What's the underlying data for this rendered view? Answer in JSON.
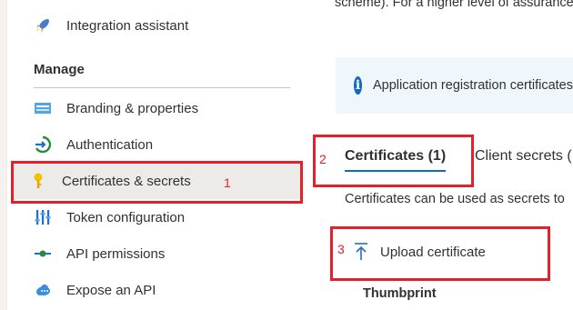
{
  "sidebar": {
    "top_item": {
      "label": "Integration assistant",
      "icon": "rocket-icon"
    },
    "section_label": "Manage",
    "items": [
      {
        "label": "Branding & properties",
        "icon": "branding-icon"
      },
      {
        "label": "Authentication",
        "icon": "authentication-icon"
      },
      {
        "label": "Certificates & secrets",
        "icon": "key-icon",
        "selected": true
      },
      {
        "label": "Token configuration",
        "icon": "token-config-icon"
      },
      {
        "label": "API permissions",
        "icon": "api-permissions-icon"
      },
      {
        "label": "Expose an API",
        "icon": "cloud-icon"
      }
    ]
  },
  "main": {
    "top_text": "scheme). For a higher level of assurance",
    "info_banner": {
      "icon": "info-icon",
      "text": "Application registration certificates"
    },
    "tabs": [
      {
        "label": "Certificates (1)",
        "active": true
      },
      {
        "label": "Client secrets (",
        "active": false
      }
    ],
    "description": "Certificates can be used as secrets to",
    "upload_button": {
      "label": "Upload certificate",
      "icon": "upload-icon"
    },
    "table": {
      "columns": [
        "Thumbprint"
      ]
    }
  },
  "annotations": [
    "1",
    "2",
    "3"
  ],
  "colors": {
    "annotation": "#e3202c",
    "accent": "#0f6cbd",
    "selected_bg": "#edebe9",
    "banner_bg": "#eff6fc"
  }
}
